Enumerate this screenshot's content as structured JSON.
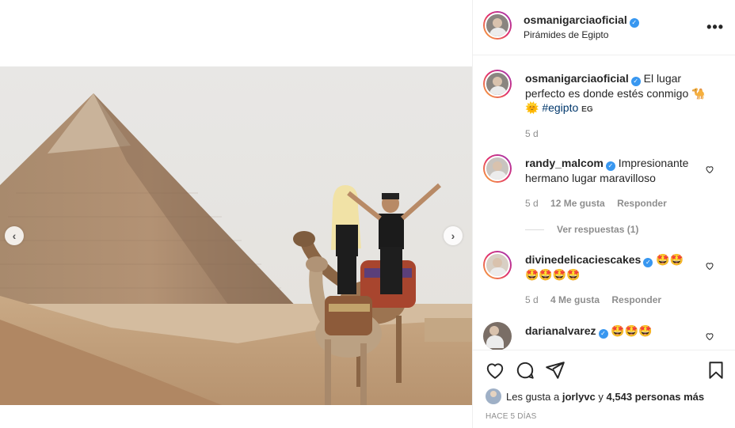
{
  "post": {
    "username": "osmanigarciaoficial",
    "location": "Pirámides de Egipto",
    "more_label": "•••"
  },
  "caption": {
    "username": "osmanigarciaoficial",
    "text": "El lugar perfecto es donde estés conmigo 🐪",
    "text2": "🌞",
    "hashtag": "#egipto",
    "flag": "EG",
    "time": "5 d"
  },
  "comments": [
    {
      "username": "randy_malcom",
      "text": "Impresionante hermano lugar maravilloso",
      "time": "5 d",
      "likes": "12 Me gusta",
      "reply": "Responder",
      "view_replies": "Ver respuestas (1)"
    },
    {
      "username": "divinedelicaciescakes",
      "text": "🤩🤩",
      "text2": "🤩🤩🤩🤩",
      "time": "5 d",
      "likes": "4 Me gusta",
      "reply": "Responder"
    },
    {
      "username": "darianalvarez",
      "text": "🤩🤩🤩"
    }
  ],
  "likes": {
    "prefix": "Les gusta a",
    "user": "jorlyvc",
    "middle": "y",
    "count": "4,543 personas más"
  },
  "date": "HACE 5 DÍAS",
  "nav": {
    "prev": "‹",
    "next": "›"
  },
  "colors": {
    "accent": "#3897f0",
    "hashtag": "#00376b",
    "muted": "#8e8e8e"
  }
}
